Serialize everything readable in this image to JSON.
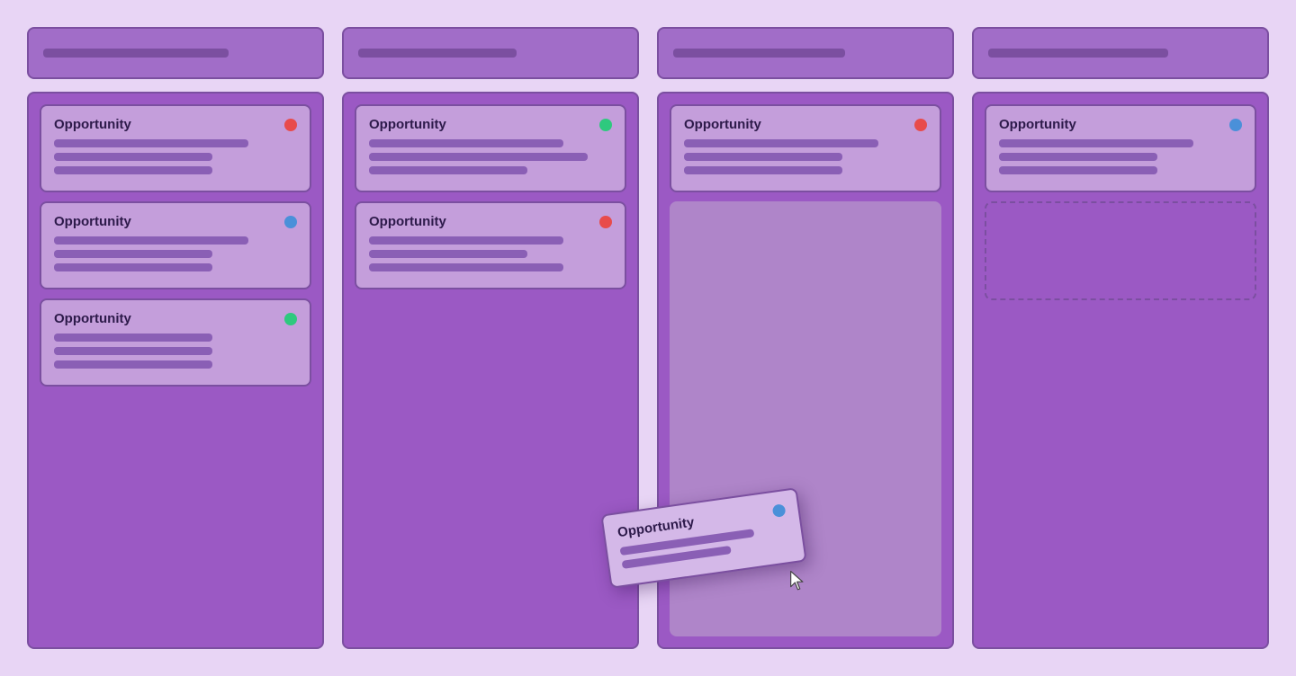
{
  "board": {
    "background": "#e8d5f5",
    "columns": [
      {
        "id": "col1",
        "header": {},
        "cards": [
          {
            "title": "Opportunity",
            "dot": "red",
            "lines": [
              "long",
              "medium",
              "medium"
            ]
          },
          {
            "title": "Opportunity",
            "dot": "blue",
            "lines": [
              "long",
              "medium",
              "medium"
            ]
          },
          {
            "title": "Opportunity",
            "dot": "green",
            "lines": [
              "medium",
              "medium",
              "medium"
            ]
          }
        ]
      },
      {
        "id": "col2",
        "header": {},
        "cards": [
          {
            "title": "Opportunity",
            "dot": "teal",
            "lines": [
              "long",
              "xlong",
              "medium"
            ]
          },
          {
            "title": "Opportunity",
            "dot": "red",
            "lines": [
              "long",
              "medium",
              "long"
            ]
          }
        ]
      },
      {
        "id": "col3",
        "header": {},
        "cards": [
          {
            "title": "Opportunity",
            "dot": "red",
            "lines": [
              "long",
              "medium",
              "medium"
            ]
          }
        ],
        "hasDragGhost": true,
        "draggedCard": {
          "title": "Opportunity",
          "dot": "blue",
          "lines": [
            "long",
            "medium"
          ]
        }
      },
      {
        "id": "col4",
        "header": {},
        "cards": [
          {
            "title": "Opportunity",
            "dot": "blue",
            "lines": [
              "long",
              "medium",
              "medium"
            ]
          }
        ],
        "hasDropPlaceholder": true
      }
    ]
  }
}
